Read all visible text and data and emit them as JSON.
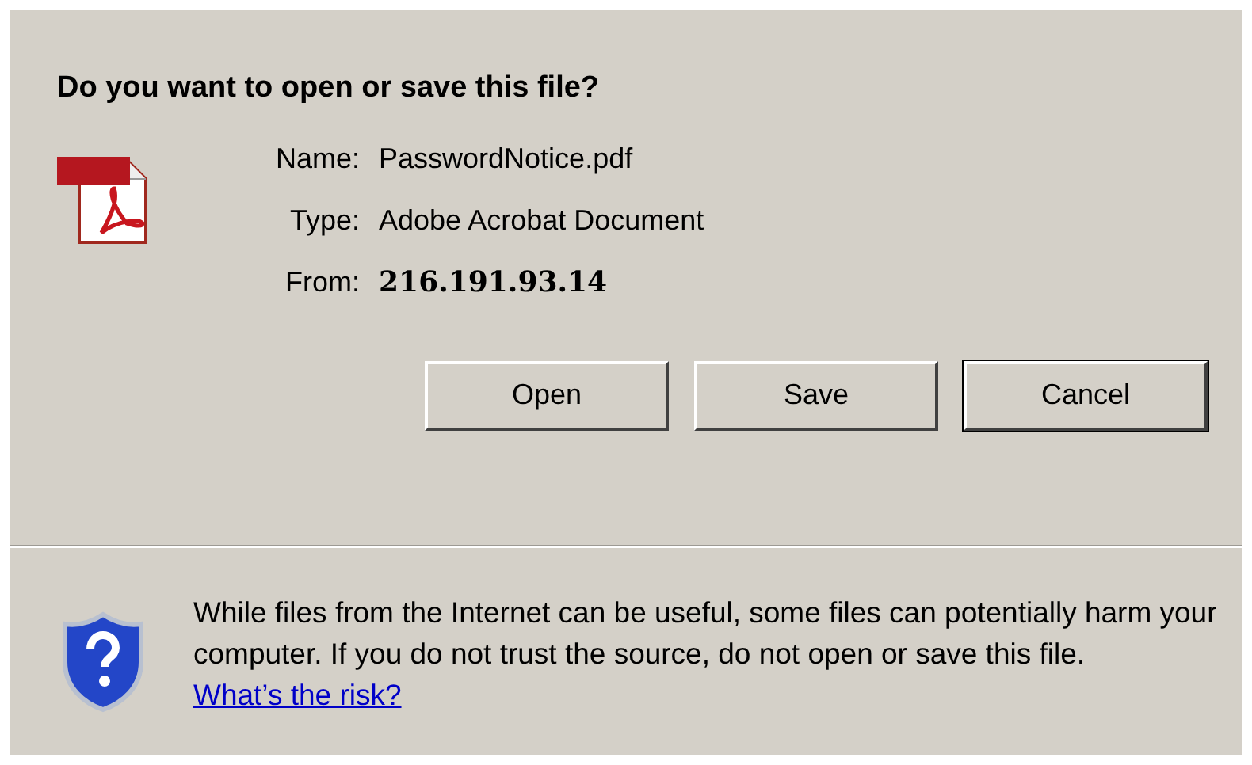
{
  "dialog": {
    "question": "Do you want to open or save this file?",
    "file": [
      {
        "label": "Name:",
        "value": "PasswordNotice.pdf",
        "bold": false
      },
      {
        "label": "Type:",
        "value": "Adobe Acrobat Document",
        "bold": false
      },
      {
        "label": "From:",
        "value": "216.191.93.14",
        "bold": true
      }
    ],
    "buttons": [
      {
        "label": "Open",
        "default": false
      },
      {
        "label": "Save",
        "default": false
      },
      {
        "label": "Cancel",
        "default": true
      }
    ],
    "warning": {
      "text": "While files from the Internet can be useful, some files can potentially harm your computer. If you do not trust the source, do not open or save this file.",
      "link": "What’s the risk?"
    }
  }
}
